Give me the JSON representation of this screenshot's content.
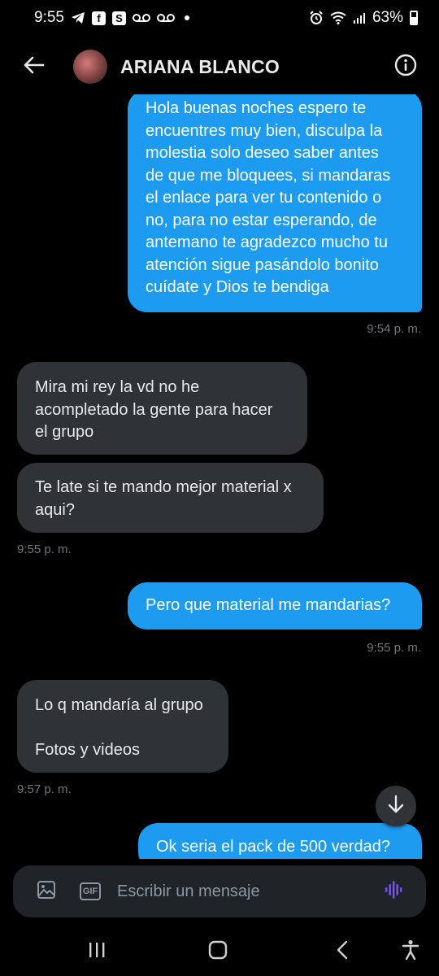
{
  "status_bar": {
    "time": "9:55",
    "battery": "63%",
    "app_icon_letter": "S"
  },
  "header": {
    "contact_name": "ARIANA BLANCO"
  },
  "messages": [
    {
      "type": "sent",
      "lines": [
        "Hola buenas noches espero te",
        "encuentres muy bien, disculpa la",
        "molestia solo deseo saber antes",
        "de que me bloquees, si mandaras",
        "el enlace para ver tu contenido o",
        "no, para no estar esperando, de",
        "antemano te agradezco mucho tu",
        "atención sigue pasándolo bonito",
        "cuídate y Dios te bendiga"
      ],
      "time": "9:54 p. m."
    },
    {
      "type": "received",
      "lines": [
        "Mira mi rey la vd no he",
        "acompletado la gente para hacer",
        "el grupo"
      ]
    },
    {
      "type": "received",
      "lines": [
        "Te late si te mando mejor material x",
        "aqui?"
      ],
      "time": "9:55 p. m."
    },
    {
      "type": "sent",
      "lines": [
        "Pero que material me mandarias?"
      ],
      "time": "9:55 p. m."
    },
    {
      "type": "received",
      "lines": [
        "Lo q mandaría al grupo",
        "",
        "Fotos y videos"
      ],
      "time": "9:57 p. m."
    },
    {
      "type": "sent",
      "lines": [
        "Ok seria el pack de 500 verdad?"
      ]
    }
  ],
  "composer": {
    "placeholder": "Escribir un mensaje",
    "gif_label": "GIF"
  },
  "icons": {
    "back": "arrow-left-icon",
    "info": "info-circle-icon",
    "scroll_down": "arrow-down-icon",
    "image": "image-icon",
    "gif": "gif-icon",
    "voice": "voice-wave-icon"
  },
  "colors": {
    "sent_bubble": "#1d9bf0",
    "received_bubble": "#2f3336",
    "background": "#000000",
    "voice_accent": "#7856ff"
  }
}
